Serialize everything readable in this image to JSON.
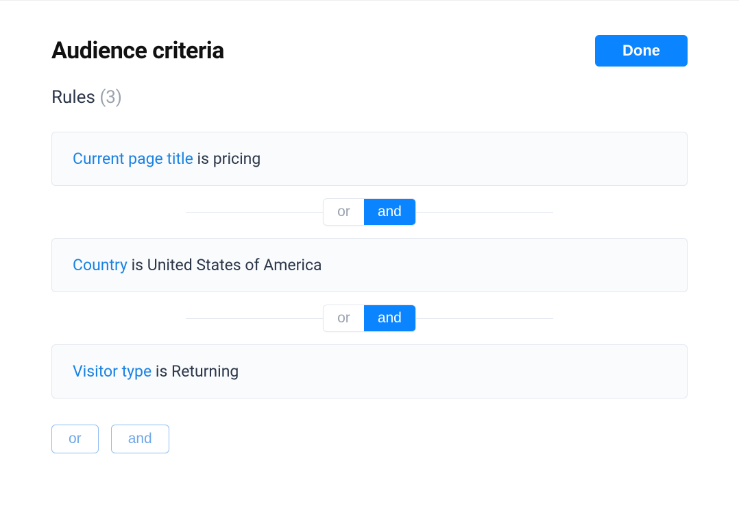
{
  "header": {
    "title": "Audience criteria",
    "done_label": "Done"
  },
  "rules_section": {
    "label": "Rules",
    "count_display": "(3)"
  },
  "rules": [
    {
      "attribute": "Current page title",
      "operator": "is",
      "value": "pricing"
    },
    {
      "attribute": "Country",
      "operator": "is",
      "value": "United States of America"
    },
    {
      "attribute": "Visitor type",
      "operator": "is",
      "value": "Returning"
    }
  ],
  "connectors": [
    {
      "or_label": "or",
      "and_label": "and",
      "selected": "and"
    },
    {
      "or_label": "or",
      "and_label": "and",
      "selected": "and"
    }
  ],
  "add_rule": {
    "or_label": "or",
    "and_label": "and"
  }
}
